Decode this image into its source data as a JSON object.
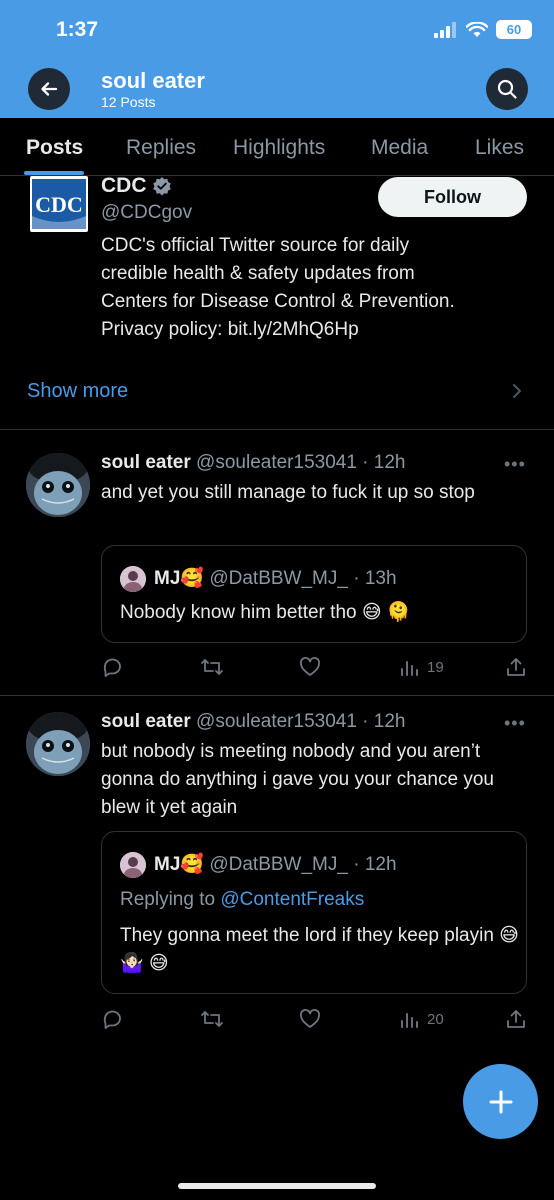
{
  "status_bar": {
    "time": "1:37",
    "battery": "60"
  },
  "header": {
    "title": "soul eater",
    "subtitle": "12 Posts"
  },
  "tabs": [
    {
      "label": "Posts",
      "active": true
    },
    {
      "label": "Replies"
    },
    {
      "label": "Highlights"
    },
    {
      "label": "Media"
    },
    {
      "label": "Likes"
    }
  ],
  "pinned_card": {
    "logo_text": "CDC",
    "name": "CDC",
    "handle": "@CDCgov",
    "follow_label": "Follow",
    "bio_lines": [
      "CDC's official Twitter source for daily",
      "credible health & safety updates from",
      "Centers for Disease Control & Prevention.",
      "Privacy policy: bit.ly/2MhQ6Hp"
    ],
    "show_more": "Show more"
  },
  "tweets": [
    {
      "name": "soul eater",
      "meta": "@souleater153041 · 12h",
      "text": "and yet you still manage to fuck it up so stop",
      "quote": {
        "name": "MJ🥰",
        "meta": "@DatBBW_MJ_ · 13h",
        "replying_prefix": "",
        "replying_to": "",
        "text": "Nobody know him better tho 😅 🫠"
      },
      "views": "19"
    },
    {
      "name": "soul eater",
      "meta": "@souleater153041 · 12h",
      "text": "but nobody is meeting nobody and you aren’t gonna do anything i gave you your chance you blew it yet again",
      "quote": {
        "name": "MJ🥰",
        "meta": "@DatBBW_MJ_ · 12h",
        "replying_prefix": "Replying to",
        "replying_to": "@ContentFreaks",
        "text": "They gonna meet the lord if they keep playin 😅 🤷🏻‍♀️ 😅"
      },
      "views": "20"
    }
  ],
  "colors": {
    "accent": "#4a9be6",
    "background": "#000000",
    "muted": "#8b98a5",
    "border": "#2f3336"
  },
  "icons": [
    "back-arrow-icon",
    "search-icon",
    "verified-badge-icon",
    "chevron-right-icon",
    "more-icon",
    "reply-icon",
    "retweet-icon",
    "like-icon",
    "views-icon",
    "share-icon",
    "compose-plus-icon"
  ]
}
